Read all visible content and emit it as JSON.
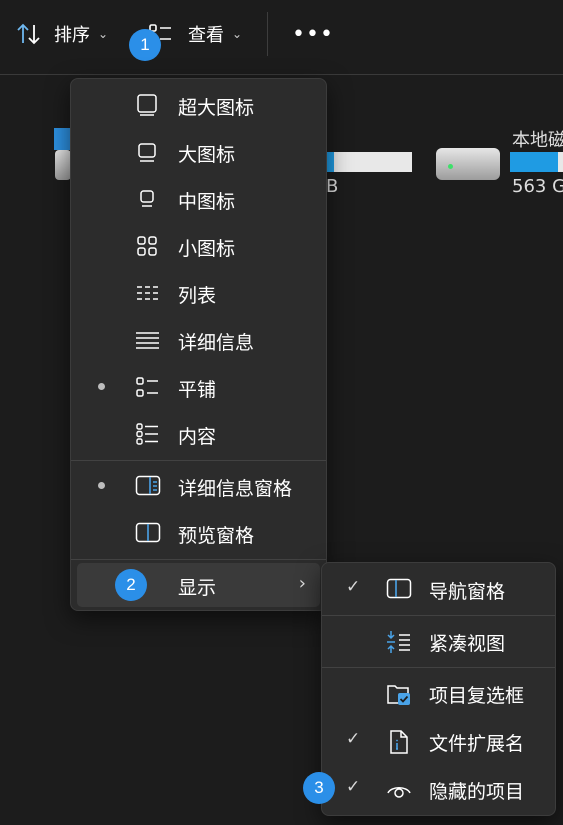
{
  "toolbar": {
    "sort_label": "排序",
    "view_label": "查看",
    "more_label": "•••"
  },
  "drives": {
    "left_size_suffix": "B",
    "right_name": "本地磁",
    "right_size": "563 G",
    "left_fill_fraction": 0.1,
    "right_fill_fraction": 0.9
  },
  "menu": {
    "items": [
      {
        "label": "超大图标",
        "icon": "extra-large-icons-icon",
        "selected": false
      },
      {
        "label": "大图标",
        "icon": "large-icons-icon",
        "selected": false
      },
      {
        "label": "中图标",
        "icon": "medium-icons-icon",
        "selected": false
      },
      {
        "label": "小图标",
        "icon": "small-icons-icon",
        "selected": false
      },
      {
        "label": "列表",
        "icon": "list-icon",
        "selected": false
      },
      {
        "label": "详细信息",
        "icon": "details-icon",
        "selected": false
      },
      {
        "label": "平铺",
        "icon": "tiles-icon",
        "selected": true
      },
      {
        "label": "内容",
        "icon": "content-icon",
        "selected": false
      }
    ],
    "panes": [
      {
        "label": "详细信息窗格",
        "icon": "details-pane-icon",
        "selected": true
      },
      {
        "label": "预览窗格",
        "icon": "preview-pane-icon",
        "selected": false
      }
    ],
    "show_label": "显示"
  },
  "submenu": {
    "items": [
      {
        "label": "导航窗格",
        "icon": "navigation-pane-icon",
        "checked": true
      },
      {
        "label": "紧凑视图",
        "icon": "compact-view-icon",
        "checked": false
      },
      {
        "label": "项目复选框",
        "icon": "item-checkbox-icon",
        "checked": false
      },
      {
        "label": "文件扩展名",
        "icon": "file-extension-icon",
        "checked": true
      },
      {
        "label": "隐藏的项目",
        "icon": "hidden-items-icon",
        "checked": true
      }
    ]
  },
  "badges": [
    "1",
    "2",
    "3"
  ],
  "colors": {
    "accent": "#2b8fe8",
    "icon_blue": "#4aa3e8",
    "capacity_fill": "#1f9be3"
  }
}
